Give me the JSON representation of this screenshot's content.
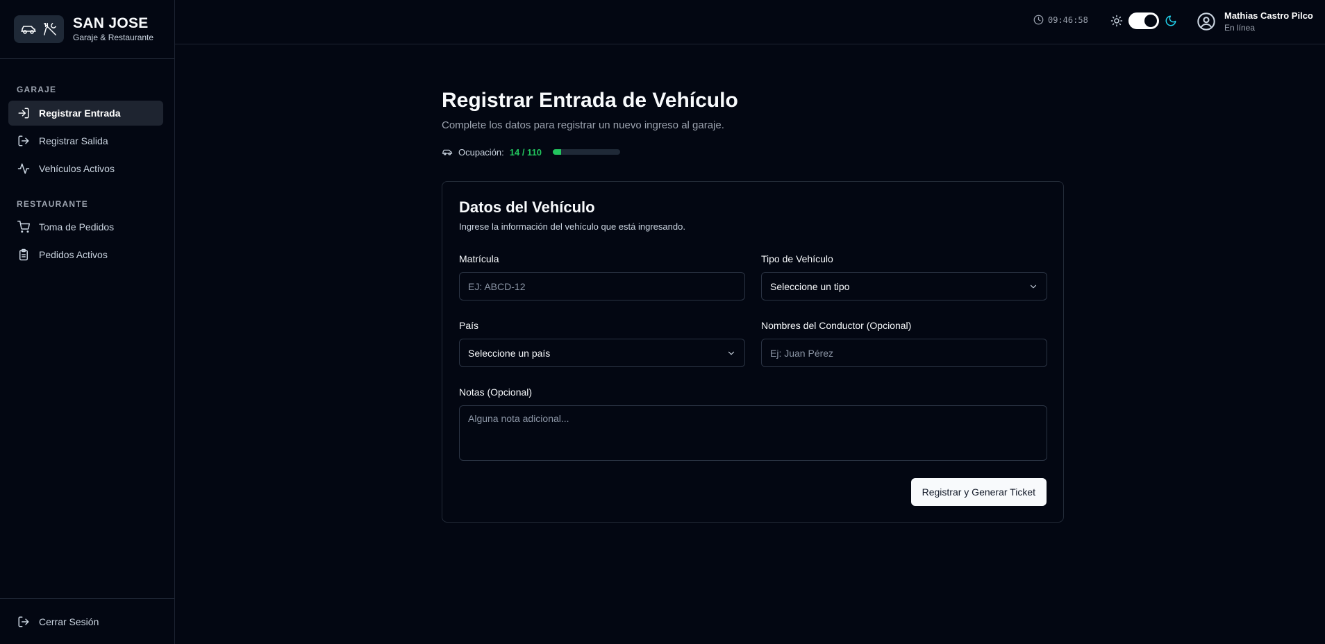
{
  "brand": {
    "title": "SAN JOSE",
    "subtitle": "Garaje & Restaurante"
  },
  "sidebar": {
    "sections": [
      {
        "title": "GARAJE"
      },
      {
        "title": "RESTAURANTE"
      }
    ],
    "items": [
      {
        "label": "Registrar Entrada",
        "icon": "log-in-icon",
        "active": true
      },
      {
        "label": "Registrar Salida",
        "icon": "log-out-icon",
        "active": false
      },
      {
        "label": "Vehículos Activos",
        "icon": "activity-icon",
        "active": false
      },
      {
        "label": "Toma de Pedidos",
        "icon": "cart-icon",
        "active": false
      },
      {
        "label": "Pedidos Activos",
        "icon": "clipboard-icon",
        "active": false
      }
    ],
    "logout_label": "Cerrar Sesión"
  },
  "header": {
    "clock": "09:46:58",
    "theme": "dark",
    "user_name": "Mathias Castro Pilco",
    "user_status": "En línea"
  },
  "main": {
    "title": "Registrar Entrada de Vehículo",
    "subtitle": "Complete los datos para registrar un nuevo ingreso al garaje.",
    "occupancy_label": "Ocupación:",
    "occupancy_value": "14 / 110",
    "occupancy_fraction": 0.127
  },
  "form": {
    "title": "Datos del Vehículo",
    "subtitle": "Ingrese la información del vehículo que está ingresando.",
    "plate_label": "Matrícula",
    "plate_placeholder": "EJ: ABCD-12",
    "type_label": "Tipo de Vehículo",
    "type_value": "Seleccione un tipo",
    "country_label": "País",
    "country_value": "Seleccione un país",
    "driver_label": "Nombres del Conductor (Opcional)",
    "driver_placeholder": "Ej: Juan Pérez",
    "notes_label": "Notas (Opcional)",
    "notes_placeholder": "Alguna nota adicional...",
    "submit_label": "Registrar y Generar Ticket"
  },
  "colors": {
    "background": "#030712",
    "accent_green": "#22c55e",
    "moon_cyan": "#22d3ee"
  }
}
